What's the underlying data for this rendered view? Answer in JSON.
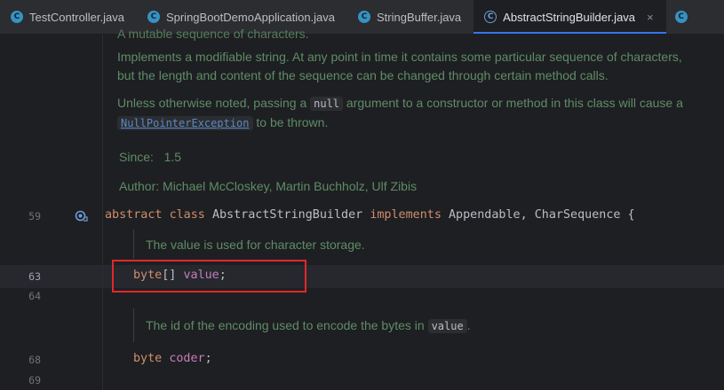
{
  "tabs": [
    {
      "label": "TestController.java",
      "icon": "class-icon",
      "active": false
    },
    {
      "label": "SpringBootDemoApplication.java",
      "icon": "class-icon",
      "active": false
    },
    {
      "label": "StringBuffer.java",
      "icon": "class-icon",
      "active": false
    },
    {
      "label": "AbstractStringBuilder.java",
      "icon": "class-icon",
      "active": true,
      "close": "×"
    }
  ],
  "javadoc": {
    "cut_line": "A mutable sequence of characters.",
    "p1_line1": "Implements a modifiable string. At any point in time it contains some particular sequence of characters,",
    "p1_line2": "but the length and content of the sequence can be changed through certain method calls.",
    "p2_before": "Unless otherwise noted, passing a ",
    "p2_null": "null",
    "p2_after": " argument to a constructor or method in this class will cause a",
    "p2_exception": "NullPointerException",
    "p2_end": " to be thrown.",
    "since_label": "Since:",
    "since_value": "1.5",
    "author_label": "Author:",
    "author_value": "Michael McCloskey, Martin Buchholz, Ulf Zibis"
  },
  "code": {
    "line_59": "59",
    "decl_abstract": "abstract",
    "decl_class": "class",
    "decl_name": "AbstractStringBuilder",
    "decl_implements": "implements",
    "decl_rest": "Appendable, CharSequence {",
    "doc_value": "The value is used for character storage.",
    "line_63": "63",
    "field1_type": "byte",
    "field1_brackets": "[] ",
    "field1_name": "value",
    "field1_semi": ";",
    "line_64": "64",
    "doc_coder_before": "The id of the encoding used to encode the bytes in ",
    "doc_coder_code": "value",
    "doc_coder_end": ".",
    "line_68": "68",
    "field2_type": "byte",
    "field2_name": "coder",
    "field2_semi": ";",
    "line_69": "69"
  },
  "colors": {
    "background": "#1e1f22",
    "keyword": "#cf8e6d",
    "field": "#c77dbb",
    "doc_text": "#5f8c67",
    "highlight_box": "#e0282e",
    "accent": "#3574f0"
  }
}
